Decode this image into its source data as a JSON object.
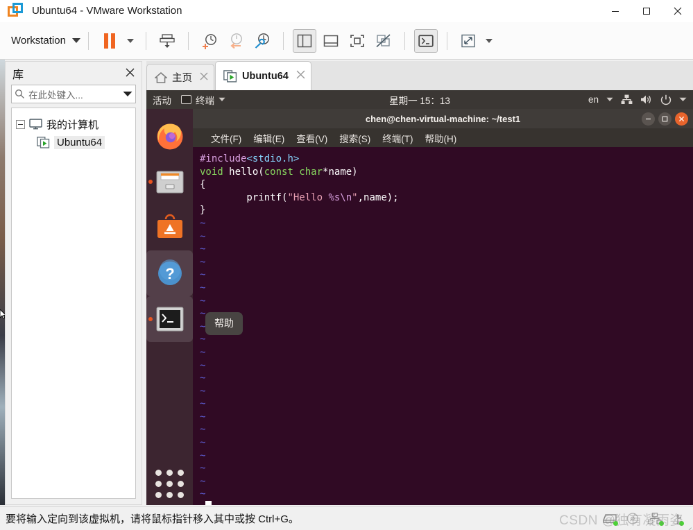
{
  "window": {
    "title": "Ubuntu64 - VMware Workstation",
    "logo_icon": "vmware-logo-icon",
    "minimize_label": "–",
    "maximize_label": "□",
    "close_label": "✕"
  },
  "toolbar": {
    "workstation_label": "Workstation",
    "items": [
      {
        "name": "pause-vm-button",
        "icon": "pause-icon",
        "label": ""
      },
      {
        "name": "pause-dropdown",
        "icon": "chevron-down-icon",
        "label": ""
      },
      {
        "name": "send-ctrl-alt-del-button",
        "icon": "send-keys-icon",
        "label": ""
      },
      {
        "name": "take-snapshot-button",
        "icon": "snapshot-add-icon",
        "label": ""
      },
      {
        "name": "revert-snapshot-button",
        "icon": "snapshot-revert-icon",
        "label": ""
      },
      {
        "name": "manage-snapshots-button",
        "icon": "snapshot-manage-icon",
        "label": ""
      },
      {
        "name": "show-library-button",
        "icon": "sidebar-panel-icon",
        "label": ""
      },
      {
        "name": "show-thumbnail-bar-button",
        "icon": "thumbnail-bar-icon",
        "label": ""
      },
      {
        "name": "fullscreen-button",
        "icon": "fullscreen-icon",
        "label": ""
      },
      {
        "name": "unity-mode-button",
        "icon": "unity-disabled-icon",
        "label": ""
      },
      {
        "name": "console-view-button",
        "icon": "terminal-icon",
        "label": ""
      },
      {
        "name": "stretch-guest-button",
        "icon": "stretch-arrows-icon",
        "label": ""
      },
      {
        "name": "stretch-dropdown",
        "icon": "chevron-down-icon",
        "label": ""
      }
    ]
  },
  "library": {
    "title": "库",
    "close_icon": "close-icon",
    "search": {
      "placeholder": "在此处键入...",
      "value": "",
      "icon": "search-icon",
      "dropdown_icon": "chevron-down-icon"
    },
    "tree": {
      "root_label": "我的计算机",
      "root_icon": "monitor-icon",
      "children": [
        {
          "label": "Ubuntu64",
          "icon": "vm-powered-on-icon",
          "selected": true
        }
      ]
    }
  },
  "tabs": [
    {
      "label": "主页",
      "icon": "home-icon",
      "active": false,
      "close_icon": "close-icon"
    },
    {
      "label": "Ubuntu64",
      "icon": "vm-powered-on-icon",
      "active": true,
      "close_icon": "close-icon"
    }
  ],
  "guest": {
    "topbar": {
      "activities_label": "活动",
      "app_name": "终端",
      "app_icon": "terminal-icon",
      "app_caret_icon": "chevron-down-icon",
      "clock": "星期一 15：13",
      "keyboard_label": "en",
      "keyboard_caret_icon": "chevron-down-icon",
      "network_icon": "network-wired-icon",
      "volume_icon": "volume-icon",
      "power_icon": "power-icon",
      "menu_caret_icon": "chevron-down-icon"
    },
    "dock": {
      "items": [
        {
          "name": "dock-item-firefox",
          "icon": "firefox-icon",
          "running": false,
          "focused": false
        },
        {
          "name": "dock-item-files",
          "icon": "files-icon",
          "running": true,
          "focused": false
        },
        {
          "name": "dock-item-ubuntu-software",
          "icon": "ubuntu-software-icon",
          "running": false,
          "focused": false
        },
        {
          "name": "dock-item-help",
          "icon": "help-icon",
          "running": false,
          "focused": true
        },
        {
          "name": "dock-item-terminal",
          "icon": "terminal-icon",
          "running": true,
          "focused": true
        }
      ],
      "show_apps_icon": "grid-apps-icon"
    },
    "terminal": {
      "title": "chen@chen-virtual-machine: ~/test1",
      "minimize_label": "–",
      "maximize_label": "□",
      "close_label": "✕",
      "menu": [
        "文件(F)",
        "编辑(E)",
        "查看(V)",
        "搜索(S)",
        "终端(T)",
        "帮助(H)"
      ],
      "code_lines": [
        [
          {
            "t": "#include",
            "c": "c-pre"
          },
          {
            "t": "<stdio.h>",
            "c": "c-hdr"
          }
        ],
        [
          {
            "t": "void",
            "c": "c-key"
          },
          {
            "t": " hello(",
            "c": "c-plain"
          },
          {
            "t": "const char",
            "c": "c-type"
          },
          {
            "t": "*name)",
            "c": "c-plain"
          }
        ],
        [
          {
            "t": "{",
            "c": "c-plain"
          }
        ],
        [
          {
            "t": "        printf(",
            "c": "c-plain"
          },
          {
            "t": "\"Hello ",
            "c": "c-str"
          },
          {
            "t": "%s\\n",
            "c": "c-esc"
          },
          {
            "t": "\"",
            "c": "c-str"
          },
          {
            "t": ",name);",
            "c": "c-plain"
          }
        ],
        [
          {
            "t": "}",
            "c": "c-plain"
          }
        ]
      ],
      "tilde_char": "~",
      "tilde_count": 22,
      "command_line": ":",
      "cursor": "block"
    },
    "tooltip": {
      "text": "帮助"
    }
  },
  "statusbar": {
    "message": "要将输入定向到该虚拟机，请将鼠标指针移入其中或按 Ctrl+G。",
    "devices": [
      {
        "name": "hard-disk-icon",
        "connected": true
      },
      {
        "name": "cd-dvd-icon",
        "connected": false
      },
      {
        "name": "network-adapter-icon",
        "connected": true
      },
      {
        "name": "usb-icon",
        "connected": true
      }
    ],
    "watermark": "CSDN @独有凝雨姿"
  },
  "colors": {
    "vmware_orange": "#ef8421",
    "vmware_blue": "#1c9ad6",
    "ubuntu_purple": "#300a24",
    "ubuntu_orange": "#e95420",
    "status_green": "#4cd137"
  }
}
